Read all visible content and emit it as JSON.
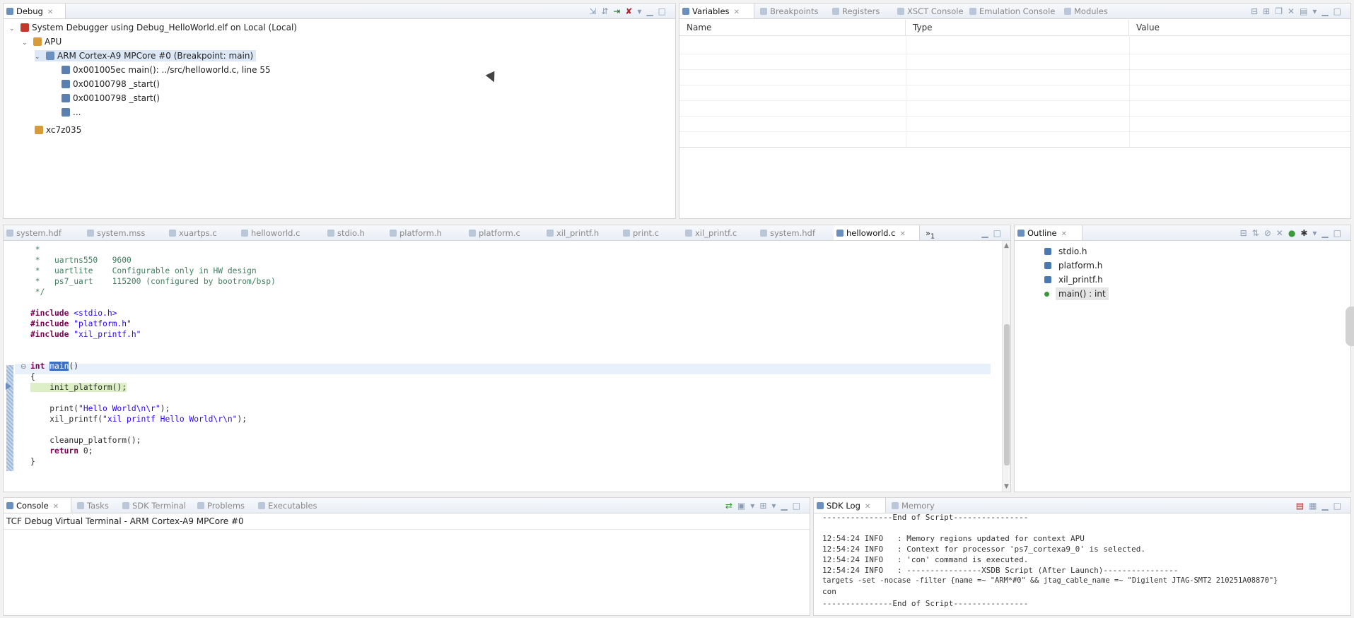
{
  "debug_view": {
    "tab_label": "Debug",
    "tree": [
      {
        "text": "System Debugger using Debug_HelloWorld.elf on Local (Local)",
        "icon": "debugger-icon"
      },
      {
        "text": "APU",
        "icon": "apu-icon"
      },
      {
        "text": "ARM Cortex-A9 MPCore #0 (Breakpoint: main)",
        "icon": "core-icon"
      },
      {
        "text": "0x001005ec main(): ../src/helloworld.c, line 55",
        "icon": "stack-frame-icon"
      },
      {
        "text": "0x00100798 _start()",
        "icon": "stack-frame-icon"
      },
      {
        "text": "0x00100798 _start()",
        "icon": "stack-frame-icon"
      },
      {
        "text": "...",
        "icon": "stack-frame-icon"
      },
      {
        "text": "xc7z035",
        "icon": "target-icon"
      }
    ]
  },
  "variables_view": {
    "tabs": [
      "Variables",
      "Breakpoints",
      "Registers",
      "XSCT Console",
      "Emulation Console",
      "Modules"
    ],
    "columns": [
      "Name",
      "Type",
      "Value"
    ]
  },
  "editor": {
    "tabs": [
      "system.hdf",
      "system.mss",
      "xuartps.c",
      "helloworld.c",
      "stdio.h",
      "platform.h",
      "platform.c",
      "xil_printf.h",
      "print.c",
      "xil_printf.c",
      "system.hdf",
      "helloworld.c"
    ],
    "overflow": "»",
    "overflow_count": "1",
    "lines": [
      {
        "text": " *",
        "kind": "cmt"
      },
      {
        "text": " *   uartns550   9600",
        "kind": "cmt"
      },
      {
        "text": " *   uartlite    Configurable only in HW design",
        "kind": "cmt"
      },
      {
        "text": " *   ps7_uart    115200 (configured by bootrom/bsp)",
        "kind": "cmt"
      },
      {
        "text": " */",
        "kind": "cmt"
      },
      {
        "text": "",
        "kind": "plain"
      },
      {
        "text": "#include <stdio.h>",
        "kind": "inc"
      },
      {
        "text": "#include \"platform.h\"",
        "kind": "inc"
      },
      {
        "text": "#include \"xil_printf.h\"",
        "kind": "inc"
      },
      {
        "text": "",
        "kind": "plain"
      },
      {
        "text": "",
        "kind": "plain"
      },
      {
        "text": "int main()",
        "kind": "main"
      },
      {
        "text": "{",
        "kind": "plain"
      },
      {
        "text": "    init_platform();",
        "kind": "current"
      },
      {
        "text": "",
        "kind": "plain"
      },
      {
        "text": "    print(\"Hello World\\n\\r\");",
        "kind": "plain"
      },
      {
        "text": "    xil_printf(\"xil printf Hello World\\r\\n\");",
        "kind": "plain"
      },
      {
        "text": "",
        "kind": "plain"
      },
      {
        "text": "    cleanup_platform();",
        "kind": "plain"
      },
      {
        "text": "    return 0;",
        "kind": "plain"
      },
      {
        "text": "}",
        "kind": "plain"
      }
    ]
  },
  "outline": {
    "tab_label": "Outline",
    "items": [
      {
        "text": "stdio.h",
        "icon": "include-icon"
      },
      {
        "text": "platform.h",
        "icon": "include-icon"
      },
      {
        "text": "xil_printf.h",
        "icon": "include-icon"
      },
      {
        "text": "main() : int",
        "icon": "function-icon"
      }
    ]
  },
  "console": {
    "tabs": [
      "Console",
      "Tasks",
      "SDK Terminal",
      "Problems",
      "Executables"
    ],
    "title": "TCF Debug Virtual Terminal - ARM Cortex-A9 MPCore #0"
  },
  "sdk_log": {
    "tabs": [
      "SDK Log",
      "Memory"
    ],
    "lines": [
      "---------------End of Script----------------",
      "",
      "12:54:24 INFO   : Memory regions updated for context APU",
      "12:54:24 INFO   : Context for processor 'ps7_cortexa9_0' is selected.",
      "12:54:24 INFO   : 'con' command is executed.",
      "12:54:24 INFO   : ----------------XSDB Script (After Launch)----------------",
      "targets -set -nocase -filter {name =~ \"ARM*#0\" && jtag_cable_name =~ \"Digilent JTAG-SMT2 210251A08870\"}",
      "con",
      "---------------End of Script----------------"
    ]
  },
  "colors": {
    "accent": "#6b8fbf",
    "selection": "#dde8f6",
    "current_line": "#dcefc6"
  }
}
